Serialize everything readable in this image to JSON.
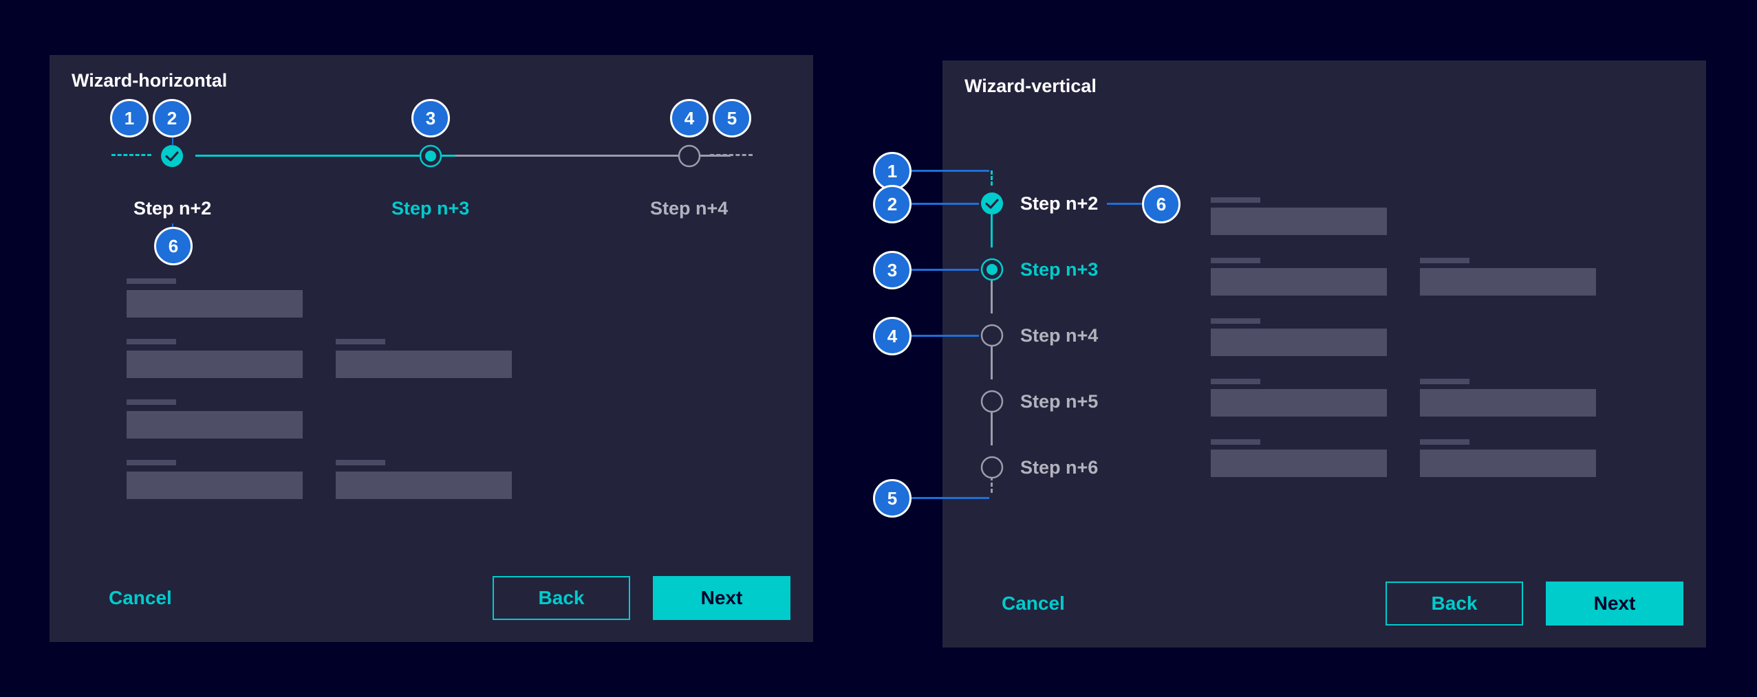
{
  "colors": {
    "background": "#000028",
    "panel": "#23233c",
    "accent": "#00cccc",
    "callout": "#1e6fd9",
    "inactive": "#9c9cab"
  },
  "horizontal": {
    "title": "Wizard-horizontal",
    "steps": [
      {
        "label": "Step n+2",
        "state": "completed",
        "icon": "check-icon"
      },
      {
        "label": "Step n+3",
        "state": "current",
        "icon": "radio-dot-icon"
      },
      {
        "label": "Step n+4",
        "state": "upcoming",
        "icon": "empty-circle-icon"
      }
    ],
    "callouts": [
      "1",
      "2",
      "3",
      "4",
      "5",
      "6"
    ],
    "cancel_label": "Cancel",
    "back_label": "Back",
    "next_label": "Next"
  },
  "vertical": {
    "title": "Wizard-vertical",
    "steps": [
      {
        "label": "Step n+2",
        "state": "completed",
        "icon": "check-icon"
      },
      {
        "label": "Step n+3",
        "state": "current",
        "icon": "radio-dot-icon"
      },
      {
        "label": "Step n+4",
        "state": "upcoming",
        "icon": "empty-circle-icon"
      },
      {
        "label": "Step n+5",
        "state": "upcoming",
        "icon": "empty-circle-icon"
      },
      {
        "label": "Step n+6",
        "state": "upcoming",
        "icon": "empty-circle-icon"
      }
    ],
    "callouts": [
      "1",
      "2",
      "3",
      "4",
      "5",
      "6"
    ],
    "cancel_label": "Cancel",
    "back_label": "Back",
    "next_label": "Next"
  }
}
